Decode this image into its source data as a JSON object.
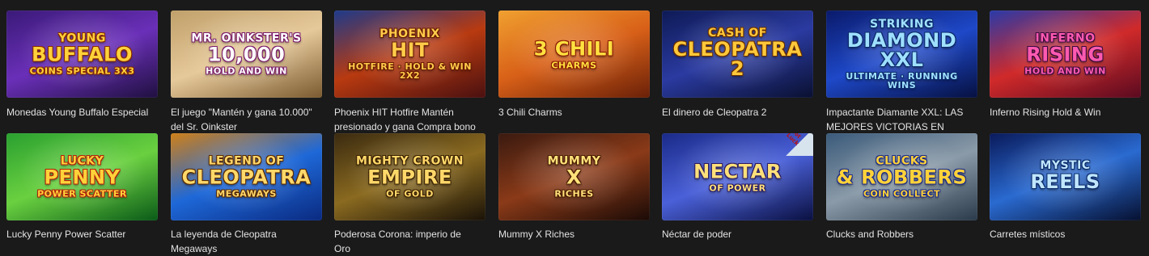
{
  "games": [
    {
      "caption": "Monedas Young Buffalo Especial",
      "art": {
        "line1": "Young",
        "line2": "Buffalo",
        "line3": "Coins Special 3x3"
      },
      "bg": [
        "#3a1a78",
        "#6a2fb8",
        "#201040"
      ],
      "text_color": "#ffd23a",
      "stroke": "#8a2b00"
    },
    {
      "caption": "El juego \"Mantén y gana 10.000\" del Sr. Oinkster",
      "art": {
        "line1": "Mr. Oinkster's",
        "line2": "10,000",
        "line3": "Hold and Win"
      },
      "bg": [
        "#c0a06a",
        "#e6c99a",
        "#7a5a30"
      ],
      "text_color": "#ffffff",
      "stroke": "#7a1a6a"
    },
    {
      "caption": "Phoenix HIT Hotfire Mantén presionado y gana Compra bono",
      "art": {
        "line1": "Phoenix",
        "line2": "HIT",
        "line3": "Hotfire · Hold & Win 2x2"
      },
      "bg": [
        "#1e3a8a",
        "#b83a10",
        "#4a1010"
      ],
      "text_color": "#ffcc4a",
      "stroke": "#6a1a00"
    },
    {
      "caption": "3 Chili Charms",
      "art": {
        "line1": "",
        "line2": "3 Chili",
        "line3": "Charms"
      },
      "bg": [
        "#f0a030",
        "#d86018",
        "#6a2008"
      ],
      "text_color": "#ffe040",
      "stroke": "#8a1a00"
    },
    {
      "caption": "El dinero de Cleopatra 2",
      "art": {
        "line1": "Cash of",
        "line2": "Cleopatra 2",
        "line3": ""
      },
      "bg": [
        "#0e1a55",
        "#2a3aa0",
        "#0a1030"
      ],
      "text_color": "#ffc83a",
      "stroke": "#6a3000"
    },
    {
      "caption": "Impactante Diamante XXL: LAS MEJORES VICTORIAS EN",
      "art": {
        "line1": "Striking",
        "line2": "Diamond XXL",
        "line3": "Ultimate · Running Wins"
      },
      "bg": [
        "#0a1a6a",
        "#1e48c8",
        "#061040"
      ],
      "text_color": "#9fe0ff",
      "stroke": "#0a2a6a"
    },
    {
      "caption": "Inferno Rising Hold & Win",
      "art": {
        "line1": "Inferno",
        "line2": "Rising",
        "line3": "Hold and Win"
      },
      "bg": [
        "#2a3aa8",
        "#d02a2a",
        "#5a0a20"
      ],
      "text_color": "#ff5ab0",
      "stroke": "#3a0a40"
    },
    {
      "caption": "Lucky Penny Power Scatter",
      "art": {
        "line1": "Lucky",
        "line2": "Penny",
        "line3": "Power Scatter"
      },
      "bg": [
        "#2aa030",
        "#6ad040",
        "#0a5a18"
      ],
      "text_color": "#ffd23a",
      "stroke": "#b0200a"
    },
    {
      "caption": "La leyenda de Cleopatra Megaways",
      "art": {
        "line1": "Legend of",
        "line2": "Cleopatra",
        "line3": "Megaways"
      },
      "bg": [
        "#d08018",
        "#1e68d8",
        "#0a2a80"
      ],
      "text_color": "#ffd86a",
      "stroke": "#5a2a00"
    },
    {
      "caption": "Poderosa Corona: imperio de Oro",
      "art": {
        "line1": "Mighty Crown",
        "line2": "Empire",
        "line3": "of Gold"
      },
      "bg": [
        "#3a2a10",
        "#8a6a20",
        "#1a1208"
      ],
      "text_color": "#ffd86a",
      "stroke": "#3a2000"
    },
    {
      "caption": "Mummy X Riches",
      "art": {
        "line1": "Mummy",
        "line2": "X",
        "line3": "Riches"
      },
      "bg": [
        "#3a1a10",
        "#8a3a18",
        "#1a0a06"
      ],
      "text_color": "#ffe27a",
      "stroke": "#4a1a00"
    },
    {
      "caption": "Néctar de poder",
      "art": {
        "line1": "",
        "line2": "Nectar",
        "line3": "of Power"
      },
      "bg": [
        "#1a2a88",
        "#4a60d8",
        "#0a1040"
      ],
      "text_color": "#ffe07a",
      "stroke": "#2a1a60",
      "badge": "Hot Luck"
    },
    {
      "caption": "Clucks and Robbers",
      "art": {
        "line1": "Clucks",
        "line2": "& Robbers",
        "line3": "Coin Collect"
      },
      "bg": [
        "#3a5a7a",
        "#8a9aa8",
        "#2a3a4a"
      ],
      "text_color": "#ffd23a",
      "stroke": "#1a2a8a"
    },
    {
      "caption": "Carretes místicos",
      "art": {
        "line1": "Mystic",
        "line2": "Reels",
        "line3": ""
      },
      "bg": [
        "#0a1a5a",
        "#2a6ad0",
        "#061030"
      ],
      "text_color": "#bfe6ff",
      "stroke": "#0a2a6a"
    }
  ]
}
